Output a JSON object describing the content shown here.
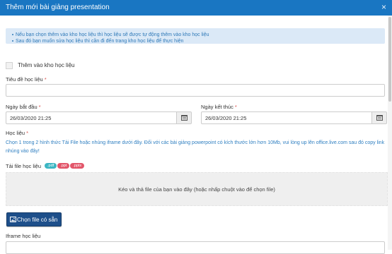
{
  "modal": {
    "title": "Thêm mới bài giảng presentation"
  },
  "info": {
    "line1": "Nếu bạn chọn thêm vào kho học liệu thì học liệu sẽ được tự động thêm vào kho học liệu",
    "line2": "Sau đó bạn muốn sửa học liệu thì cần đi đến trang kho học liệu để thực hiện"
  },
  "checkbox": {
    "label": "Thêm vào kho học liệu",
    "checked": false
  },
  "fields": {
    "title_label": "Tiêu đề học liệu",
    "title_value": "",
    "start_label": "Ngày bắt đầu",
    "start_value": "26/03/2020 21:25",
    "end_label": "Ngày kết thúc",
    "end_value": "26/03/2020 21:25",
    "material_label": "Học liệu",
    "material_help": "Chọn 1 trong 2 hình thức Tải File hoặc nhúng iframe dưới đây. Đối với các bài giảng powerpoint có kích thước lớn hơn 10Mb, vui lòng up lên office.live.com sau đó copy link nhúng vào đây!",
    "upload_label": "Tải file học liệu",
    "iframe_label": "Iframe học liệu"
  },
  "required_mark": "*",
  "file_types": [
    ".pdf",
    ".ppt",
    ".pptx"
  ],
  "dropzone": {
    "text": "Kéo và thả file của bạn vào đây (hoặc nhấp chuột vào để chọn file)"
  },
  "buttons": {
    "choose_file": "Chọn file có sẵn"
  },
  "colors": {
    "header": "#1976c2",
    "info_bg": "#dbe9f7",
    "link": "#2f7fc1",
    "button": "#1e4f8a"
  }
}
